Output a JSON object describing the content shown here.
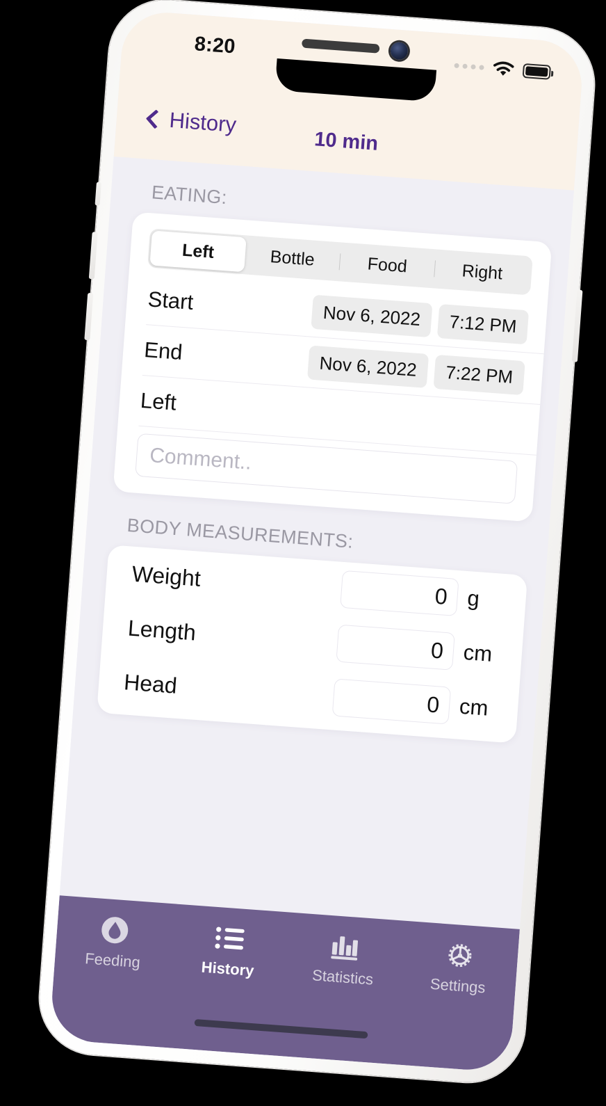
{
  "status_bar": {
    "time": "8:20",
    "cellular_icon": "cellular-dots-icon",
    "wifi_icon": "wifi-icon",
    "battery_icon": "battery-full-icon"
  },
  "nav": {
    "back_label": "History",
    "back_icon": "chevron-left-icon",
    "title": "10 min"
  },
  "eating": {
    "section_label": "EATING:",
    "segments": [
      {
        "label": "Left",
        "selected": true
      },
      {
        "label": "Bottle",
        "selected": false
      },
      {
        "label": "Food",
        "selected": false
      },
      {
        "label": "Right",
        "selected": false
      }
    ],
    "rows": [
      {
        "label": "Start",
        "date": "Nov 6, 2022",
        "time": "7:12 PM"
      },
      {
        "label": "End",
        "date": "Nov 6, 2022",
        "time": "7:22 PM"
      }
    ],
    "side_row_label": "Left",
    "comment_placeholder": "Comment..",
    "comment_value": ""
  },
  "body_measurements": {
    "section_label": "BODY MEASUREMENTS:",
    "fields": [
      {
        "label": "Weight",
        "value": "0",
        "unit": "g"
      },
      {
        "label": "Length",
        "value": "0",
        "unit": "cm"
      },
      {
        "label": "Head",
        "value": "0",
        "unit": "cm"
      }
    ]
  },
  "tabbar": {
    "items": [
      {
        "label": "Feeding",
        "icon": "droplet-icon",
        "active": false
      },
      {
        "label": "History",
        "icon": "list-icon",
        "active": true
      },
      {
        "label": "Statistics",
        "icon": "bar-chart-icon",
        "active": false
      },
      {
        "label": "Settings",
        "icon": "gear-icon",
        "active": false
      }
    ]
  },
  "colors": {
    "accent_purple": "#4f2b8c",
    "tabbar_purple": "#6f5f8e",
    "navbar_cream": "#faf2e8",
    "content_bg": "#f0eff5",
    "card_white": "#ffffff"
  }
}
